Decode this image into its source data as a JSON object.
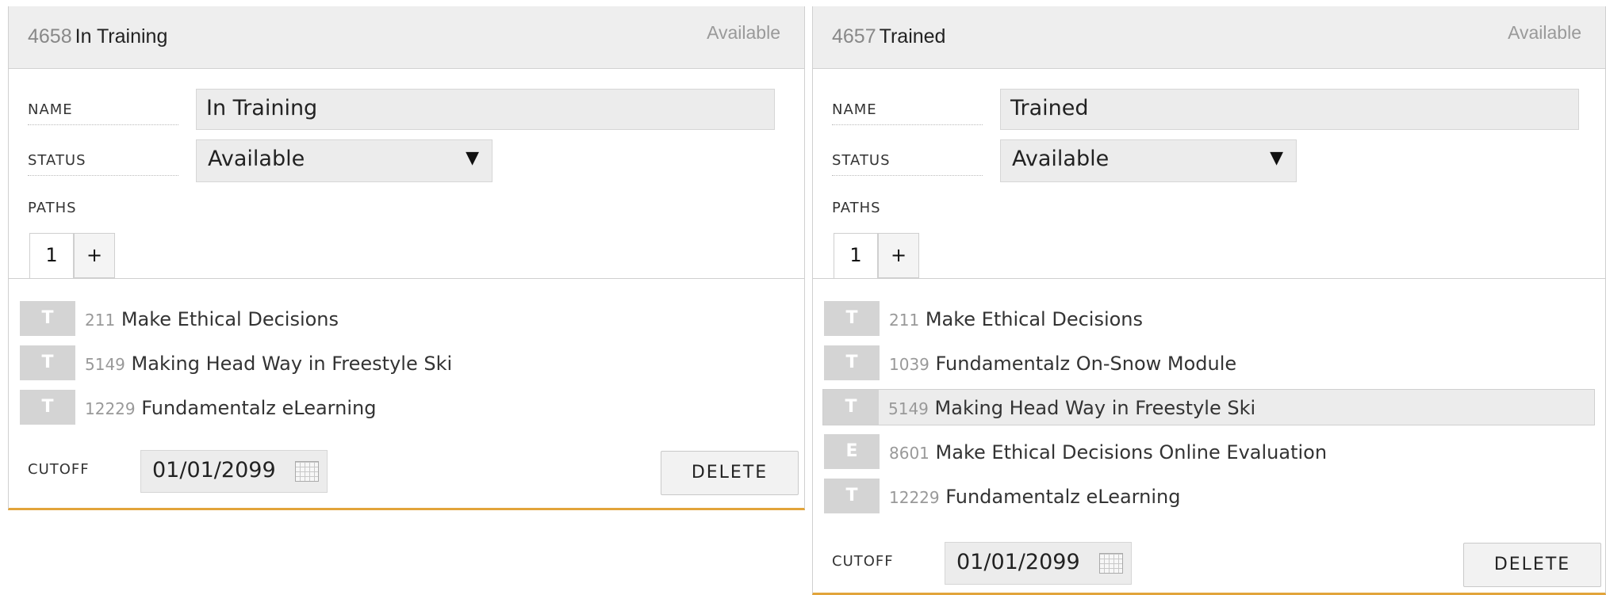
{
  "panels": [
    {
      "id": "4658",
      "title": "In Training",
      "status_badge": "Available",
      "labels": {
        "name": "NAME",
        "status": "STATUS",
        "paths": "PATHS",
        "cutoff": "CUTOFF"
      },
      "name_value": "In Training",
      "status_value": "Available",
      "tabs": [
        "1",
        "+"
      ],
      "items": [
        {
          "badge": "T",
          "num": "211",
          "name": "Make Ethical Decisions"
        },
        {
          "badge": "T",
          "num": "5149",
          "name": "Making Head Way in Freestyle Ski"
        },
        {
          "badge": "T",
          "num": "12229",
          "name": "Fundamentalz eLearning"
        }
      ],
      "cutoff_value": "01/01/2099",
      "delete_label": "DELETE"
    },
    {
      "id": "4657",
      "title": "Trained",
      "status_badge": "Available",
      "labels": {
        "name": "NAME",
        "status": "STATUS",
        "paths": "PATHS",
        "cutoff": "CUTOFF"
      },
      "name_value": "Trained",
      "status_value": "Available",
      "tabs": [
        "1",
        "+"
      ],
      "items": [
        {
          "badge": "T",
          "num": "211",
          "name": "Make Ethical Decisions"
        },
        {
          "badge": "T",
          "num": "1039",
          "name": "Fundamentalz On-Snow Module"
        },
        {
          "badge": "T",
          "num": "5149",
          "name": "Making Head Way in Freestyle Ski"
        },
        {
          "badge": "E",
          "num": "8601",
          "name": "Make Ethical Decisions Online Evaluation"
        },
        {
          "badge": "T",
          "num": "12229",
          "name": "Fundamentalz eLearning"
        }
      ],
      "cutoff_value": "01/01/2099",
      "delete_label": "DELETE"
    }
  ],
  "icons": {
    "dropdown": "dropdown-arrow-icon",
    "calendar": "calendar-icon"
  },
  "colors": {
    "accent_border": "#e2a43a",
    "badge_bg": "#d4d4d4",
    "header_bg": "#eeeeee"
  }
}
